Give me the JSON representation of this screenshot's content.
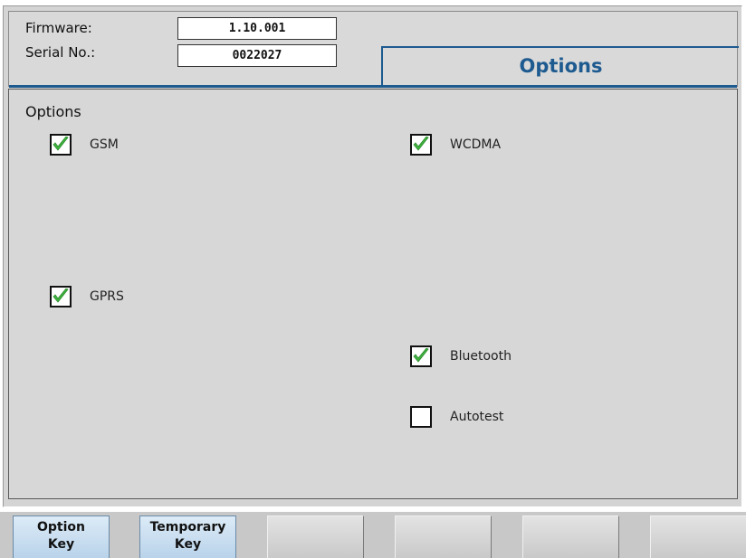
{
  "info": {
    "firmware_label": "Firmware:",
    "firmware_value": "1.10.001",
    "serial_label": "Serial No.:",
    "serial_value": "0022027"
  },
  "page_title": "Options",
  "section_heading": "Options",
  "options": {
    "gsm": {
      "label": "GSM",
      "checked": true
    },
    "wcdma": {
      "label": "WCDMA",
      "checked": true
    },
    "gprs": {
      "label": "GPRS",
      "checked": true
    },
    "bluetooth": {
      "label": "Bluetooth",
      "checked": true
    },
    "autotest": {
      "label": "Autotest",
      "checked": false
    }
  },
  "softkeys": [
    {
      "line1": "Option",
      "line2": "Key"
    },
    {
      "line1": "Temporary",
      "line2": "Key"
    },
    {
      "line1": "",
      "line2": ""
    },
    {
      "line1": "",
      "line2": ""
    },
    {
      "line1": "",
      "line2": ""
    },
    {
      "line1": "",
      "line2": ""
    }
  ],
  "colors": {
    "accent": "#1d5a8f",
    "check": "#3fb43f",
    "active_softkey": "#c6dcef"
  }
}
